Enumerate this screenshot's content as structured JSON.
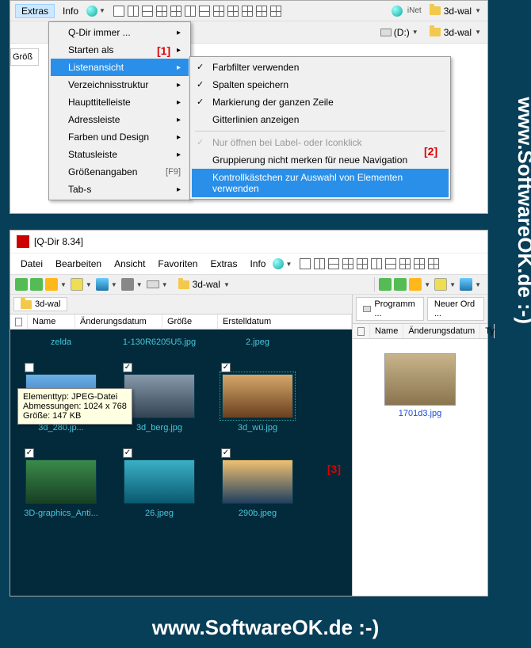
{
  "top": {
    "menubar": {
      "extras": "Extras",
      "info": "Info",
      "address_crumb": "3d-wal",
      "inet": "iNet"
    },
    "nav": {
      "drive": "(D:)",
      "folder": "3d-wal"
    },
    "size_tab": "Größ",
    "dropdown": {
      "qdir_always": "Q-Dir immer ...",
      "start_as": "Starten als",
      "listview": "Listenansicht",
      "tree": "Verzeichnisstruktur",
      "titlebar": "Haupttitelleiste",
      "addressbar": "Adressleiste",
      "colors": "Farben und Design",
      "statusbar": "Statusleiste",
      "sizes": "Größenangaben",
      "sizes_shortcut": "[F9]",
      "tabs": "Tab-s"
    },
    "submenu": {
      "color_filter": "Farbfilter verwenden",
      "save_columns": "Spalten speichern",
      "full_row": "Markierung der ganzen Zeile",
      "gridlines": "Gitterlinien anzeigen",
      "label_click": "Nur öffnen bei Label- oder Iconklick",
      "grouping": "Gruppierung nicht merken für neue Navigation",
      "checkboxes": "Kontrollkästchen zur Auswahl von Elementen verwenden"
    },
    "annot1": "[1]",
    "annot2": "[2]"
  },
  "bot": {
    "title": "[Q-Dir 8.34]",
    "menubar": {
      "file": "Datei",
      "edit": "Bearbeiten",
      "view": "Ansicht",
      "fav": "Favoriten",
      "extras": "Extras",
      "info": "Info"
    },
    "tabs_left": "3d-wal",
    "tabs_right1": "Programm ...",
    "tabs_right2": "Neuer Ord ...",
    "cols_left": {
      "name": "Name",
      "modified": "Änderungsdatum",
      "size": "Größe",
      "created": "Erstelldatum"
    },
    "cols_right": {
      "name": "Name",
      "modified": "Änderungsdatum",
      "type": "Ty"
    },
    "files_row0": [
      "zelda",
      "1-130R6205U5.jpg",
      "2.jpeg"
    ],
    "files_row1": [
      "3d_280.jp...",
      "3d_berg.jpg",
      "3d_wü.jpg"
    ],
    "files_row2": [
      "3D-graphics_Anti...",
      "26.jpeg",
      "290b.jpeg"
    ],
    "right_file": "1701d3.jpg",
    "tooltip": {
      "l1": "Elementtyp: JPEG-Datei",
      "l2": "Abmessungen: 1024 x 768",
      "l3": "Größe: 147 KB"
    },
    "annot3": "[3]",
    "address_crumb": "3d-wal"
  },
  "wm": "www.SoftwareOK.de :-)"
}
